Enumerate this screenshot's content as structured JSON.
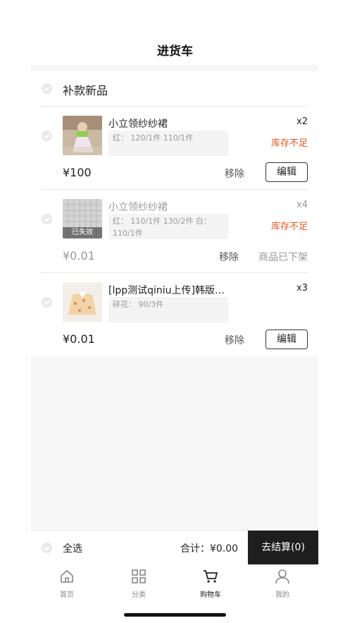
{
  "header": {
    "title": "进货车"
  },
  "group": {
    "title": "补款新品"
  },
  "items": [
    {
      "name": "小立领纱纱裙",
      "spec": "红： 120/1件 110/1件",
      "qty": "x2",
      "stock": "库存不足",
      "price": "¥100",
      "remove": "移除",
      "action": "编辑",
      "expired_tag": ""
    },
    {
      "name": "小立领纱纱裙",
      "spec": "红： 110/1件 130/2件 白： 110/1件",
      "qty": "x4",
      "stock": "库存不足",
      "price": "¥0.01",
      "remove": "移除",
      "action": "商品已下架",
      "expired_tag": "已失效"
    },
    {
      "name": "[lpp测试qiniu上传]韩版…",
      "spec": "碎花： 90/3件",
      "qty": "x3",
      "stock": "",
      "price": "¥0.01",
      "remove": "移除",
      "action": "编辑",
      "expired_tag": ""
    }
  ],
  "bottom": {
    "select_all": "全选",
    "total": "合计：¥0.00",
    "checkout": "去结算(0)"
  },
  "tabbar": [
    {
      "label": "首页",
      "icon": "home-icon"
    },
    {
      "label": "分类",
      "icon": "grid-icon"
    },
    {
      "label": "购物车",
      "icon": "cart-icon",
      "active": true
    },
    {
      "label": "我的",
      "icon": "user-icon"
    }
  ],
  "colors": {
    "accent": "#e5581f",
    "checkout_bg": "#1e1e1e"
  }
}
